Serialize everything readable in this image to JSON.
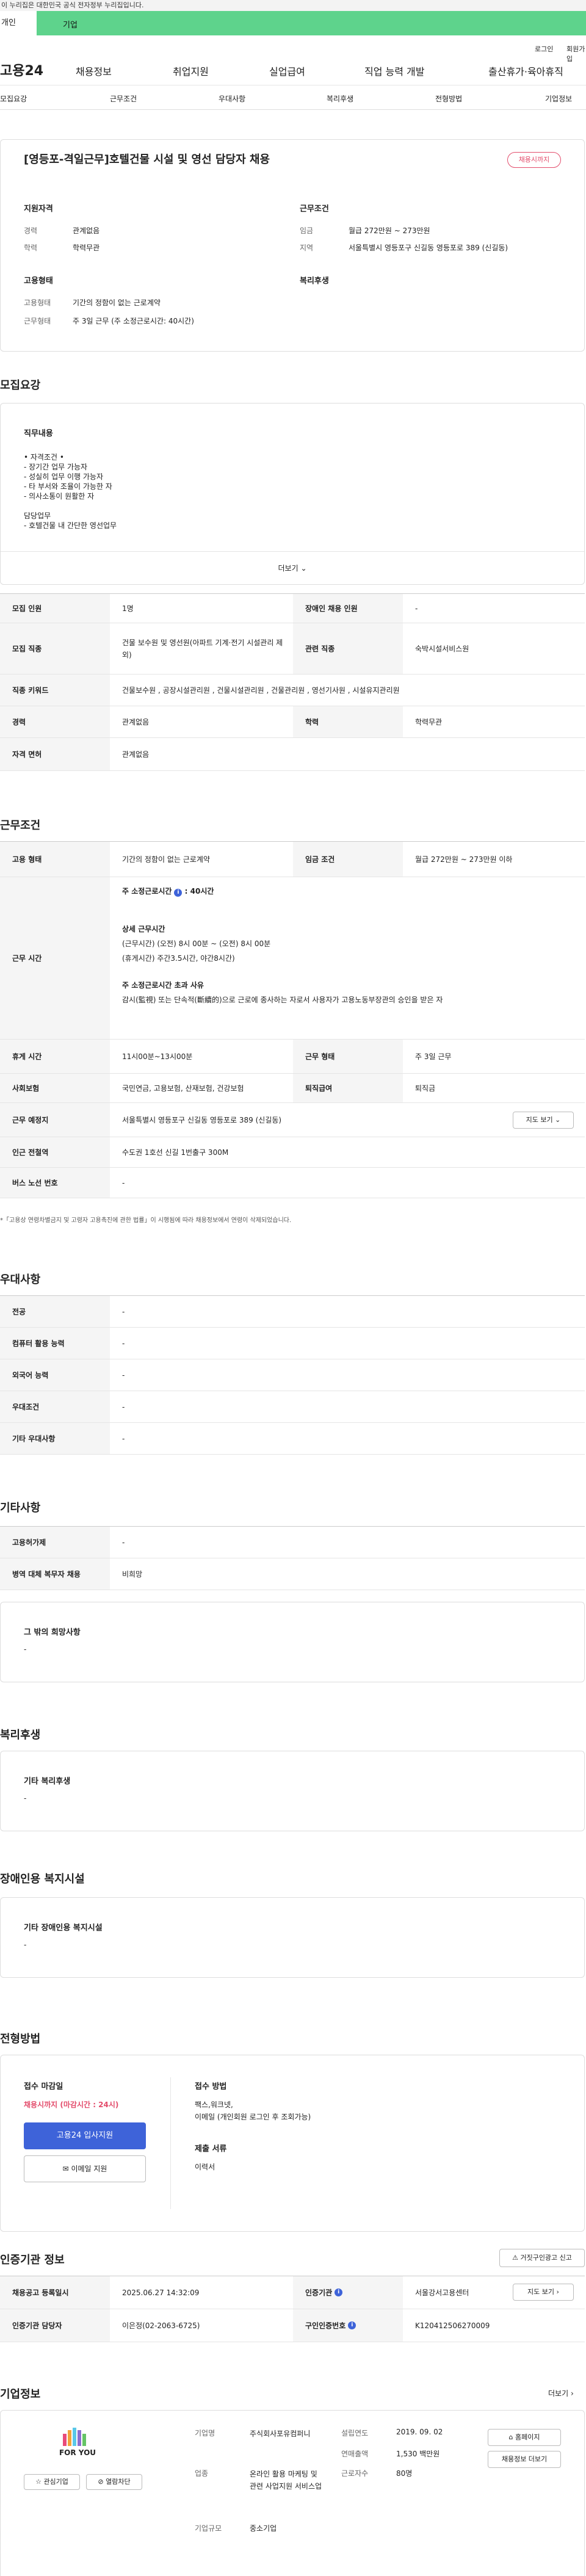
{
  "top_notice": "이 누리집은 대한민국 공식 전자정부 누리집입니다.",
  "top_tabs": [
    "개인",
    "기업"
  ],
  "util": {
    "login": "로그인",
    "join": "회원가입"
  },
  "logo": "고용24",
  "gnb": [
    "채용정보",
    "취업지원",
    "실업급여",
    "직업 능력 개발",
    "출산휴가·육아휴직"
  ],
  "subnav": [
    "모집요강",
    "근무조건",
    "우대사항",
    "복리후생",
    "전형방법",
    "기업정보"
  ],
  "job": {
    "title": "[영등포-격일근무]호텔건물 시설 및 영선 담당자 채용",
    "status": "채용시까지",
    "qual_head": "지원자격",
    "qual": [
      [
        "경력",
        "관계없음"
      ],
      [
        "학력",
        "학력무관"
      ]
    ],
    "cond_head": "근무조건",
    "cond": [
      [
        "임금",
        "월급 272만원 ~ 273만원"
      ],
      [
        "지역",
        "서울특별시 영등포구 신길동 영등포로 389 (신길동)"
      ]
    ],
    "emp_head": "고용형태",
    "emp": [
      [
        "고용형태",
        "기간의 정함이 없는 근로계약"
      ],
      [
        "근무형태",
        "주 3일 근무 (주 소정근로시간: 40시간)"
      ]
    ],
    "welfare_head": "복리후생"
  },
  "recruit": {
    "title": "모집요강",
    "duty_head": "직무내용",
    "duty_lines": [
      "• 자격조건 •",
      "- 장기간 업무 가능자",
      "- 성실히 업무 이행 가능자",
      "- 타 부서와 조율이 가능한 자",
      "- 의사소통이 원활한 자",
      "",
      "담당업무",
      "  - 호텔건물 내 간단한 영선업무"
    ],
    "more": "더보기",
    "rows": [
      [
        "모집 인원",
        "1명",
        "장애인 채용 인원",
        "-"
      ],
      [
        "모집 직종",
        "건물 보수원 및 영선원(아파트 기계·전기 시설관리 제외)",
        "관련 직종",
        "숙박시설서비스원"
      ],
      [
        "직종 키워드",
        "건물보수원 , 공장시설관리원 , 건물시설관리원 , 건물관리원 , 영선기사원 , 시설유지관리원"
      ],
      [
        "경력",
        "관계없음",
        "학력",
        "학력무관"
      ],
      [
        "자격 면허",
        "관계없음"
      ]
    ]
  },
  "work": {
    "title": "근무조건",
    "emp_label": "고용 형태",
    "emp_val": "기간의 정함이 없는 근로계약",
    "wage_label": "임금 조건",
    "wage_val": "월급 272만원 ~ 273만원 이하",
    "hours_label": "근무 시간",
    "hours_main": "주 소정근로시간",
    "hours_main_val": ": 40시간",
    "detail_head": "상세 근무시간",
    "detail_1": "(근무시간) (오전) 8시 00분 ~ (오전) 8시 00분",
    "detail_2": "(휴게시간) 주간3.5시간, 야간8시간)",
    "exceed_head": "주 소정근로시간 초과 사유",
    "exceed_text": "감시(監視) 또는 단속적(斷續的)으로 근로에 종사하는 자로서 사용자가 고용노동부장관의 승인을 받은 자",
    "rows": [
      [
        "휴게 시간",
        "11시00분~13시00분",
        "근무 형태",
        "주 3일 근무"
      ],
      [
        "사회보험",
        "국민연금, 고용보험, 산재보험, 건강보험",
        "퇴직급여",
        "퇴직금"
      ],
      [
        "근무 예정지",
        "서울특별시 영등포구 신길동 영등포로 389 (신길동)"
      ],
      [
        "인근 전철역",
        "수도권 1호선 신길 1번출구 300M"
      ],
      [
        "버스 노선 번호",
        "-"
      ]
    ],
    "map_btn": "지도 보기",
    "note": "*「고용상 연령차별금지 및 고령자 고용촉진에 관한 법률」이 시행됨에 따라 채용정보에서 연령이 삭제되었습니다."
  },
  "pref": {
    "title": "우대사항",
    "rows": [
      [
        "전공",
        "-"
      ],
      [
        "컴퓨터 활용 능력",
        "-"
      ],
      [
        "외국어 능력",
        "-"
      ],
      [
        "우대조건",
        "-"
      ],
      [
        "기타 우대사항",
        "-"
      ]
    ]
  },
  "etc": {
    "title": "기타사항",
    "rows": [
      [
        "고용허가제",
        "-"
      ],
      [
        "병역 대체 복무자 채용",
        "비희망"
      ]
    ],
    "hope_head": "그 밖의 희망사항",
    "hope_val": "-"
  },
  "welfare": {
    "title": "복리후생",
    "head": "기타 복리후생",
    "val": "-"
  },
  "disab": {
    "title": "장애인용 복지시설",
    "head": "기타 장애인용 복지시설",
    "val": "-"
  },
  "screening": {
    "title": "전형방법",
    "deadline_head": "접수 마감일",
    "deadline_val": "채용시까지 (마감시간 : 24시)",
    "apply_btn": "고용24 입사지원",
    "email_btn": "이메일 지원",
    "method_head": "접수 방법",
    "method_lines": [
      "팩스,워크넷,",
      "이메일 (개인회원 로그인 후 조회가능)"
    ],
    "docs_head": "제출 서류",
    "docs_val": "이력서"
  },
  "cert": {
    "title": "인증기관 정보",
    "report_btn": "거짓구인광고 신고",
    "rows": [
      [
        "채용공고 등록일시",
        "2025.06.27 14:32:09",
        "인증기관",
        "서울강서고용센터"
      ],
      [
        "인증기관 담당자",
        "이은정(02-2063-6725)",
        "구인인증번호",
        "K120412506270009"
      ]
    ],
    "map_btn": "지도 보기"
  },
  "company": {
    "title": "기업정보",
    "more": "더보기",
    "logo_text": "FOR YOU",
    "fav_btn": "관심기업",
    "block_btn": "열람차단",
    "info": [
      [
        "기업명",
        "주식회사포유컴퍼니"
      ],
      [
        "업종",
        "온라인 활용 마케팅 및 관련 사업지원 서비스업"
      ],
      [
        "기업규모",
        "중소기업"
      ]
    ],
    "info2": [
      [
        "설립연도",
        "2019. 09. 02"
      ],
      [
        "연매출액",
        "1,530 백만원"
      ],
      [
        "근로자수",
        "80명"
      ]
    ],
    "home_btn": "홈페이지",
    "other_btn": "채용정보 더보기"
  }
}
